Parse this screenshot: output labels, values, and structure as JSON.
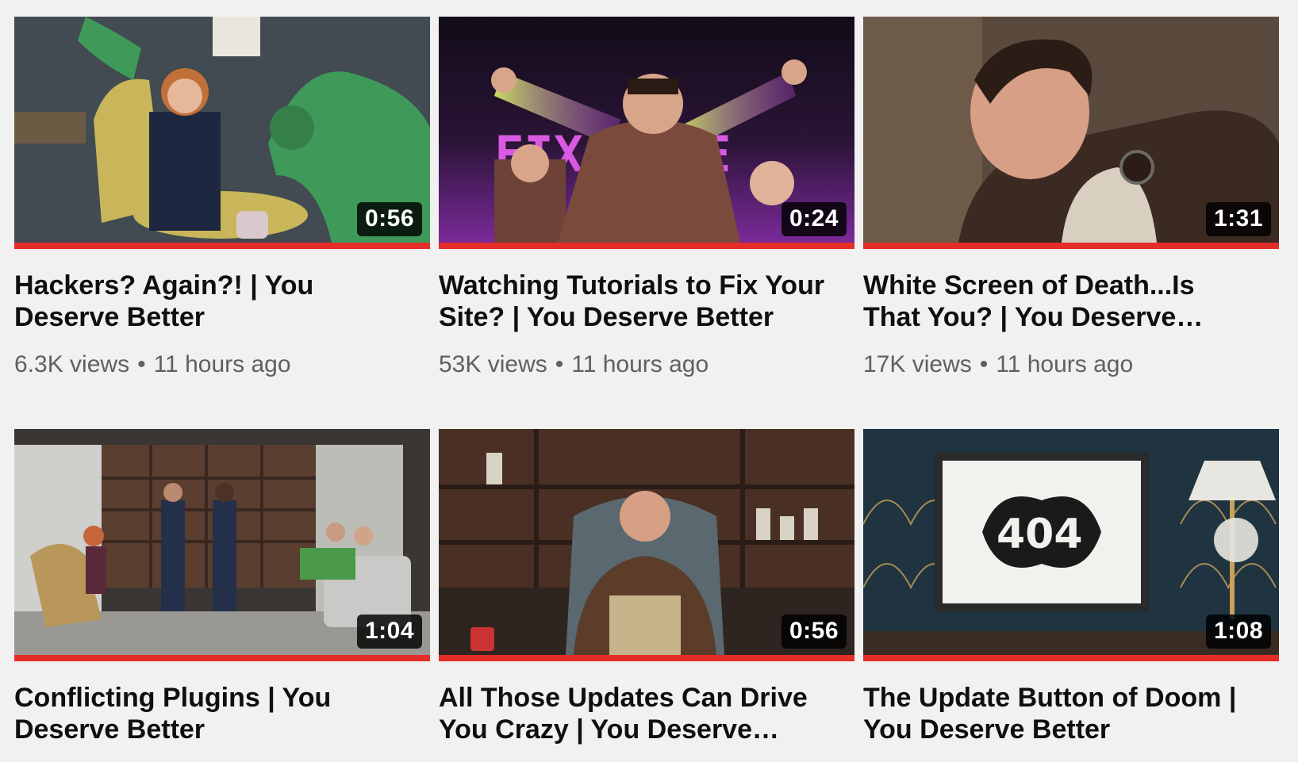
{
  "videos": [
    {
      "title": "Hackers? Again?! | You Deserve Better",
      "views": "6.3K views",
      "age": "11 hours ago",
      "duration": "0:56",
      "watched_fraction": 1.0,
      "thumb_colors": {
        "bg": "#4a5358",
        "accent": "#3f9a5a",
        "chair": "#c9b65a"
      }
    },
    {
      "title": "Watching Tutorials to Fix Your Site? | You Deserve Better",
      "views": "53K views",
      "age": "11 hours ago",
      "duration": "0:24",
      "watched_fraction": 1.0,
      "thumb_colors": {
        "bg": "#1c1424",
        "accent": "#9b3bb0",
        "chair": "#7a4a3c"
      }
    },
    {
      "title": "White Screen of Death...Is That You? | You Deserve Better",
      "views": "17K views",
      "age": "11 hours ago",
      "duration": "1:31",
      "watched_fraction": 1.0,
      "thumb_colors": {
        "bg": "#5a4a3e",
        "accent": "#3b2a22",
        "chair": "#d8cfc1"
      }
    },
    {
      "title": "Conflicting Plugins | You Deserve Better",
      "views": "",
      "age": "",
      "duration": "1:04",
      "watched_fraction": 1.0,
      "thumb_colors": {
        "bg": "#3a3633",
        "accent": "#4a9a4a",
        "chair": "#b9975a"
      }
    },
    {
      "title": "All Those Updates Can Drive You Crazy | You Deserve Better",
      "views": "",
      "age": "",
      "duration": "0:56",
      "watched_fraction": 1.0,
      "thumb_colors": {
        "bg": "#2e2420",
        "accent": "#5a6870",
        "chair": "#5b3d2a"
      }
    },
    {
      "title": "The Update Button of Doom | You Deserve Better",
      "views": "",
      "age": "",
      "duration": "1:08",
      "watched_fraction": 1.0,
      "thumb_colors": {
        "bg": "#1f3340",
        "accent": "#c8a25a",
        "chair": "#e8e6e0"
      }
    }
  ],
  "separator": "•",
  "thumbnail_text": {
    "video2_sign": "FIX TIME",
    "video6_sign": "404"
  }
}
